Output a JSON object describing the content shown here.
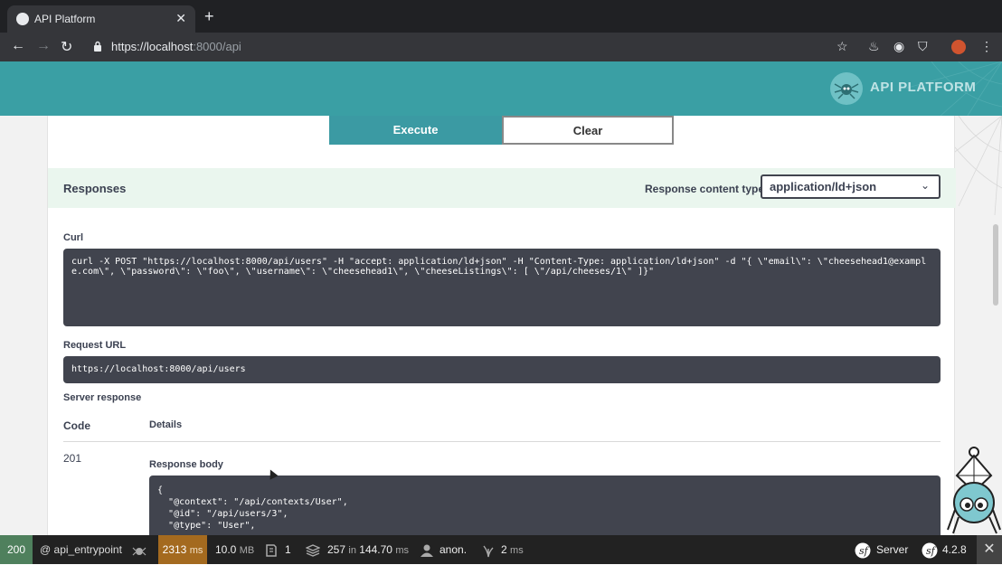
{
  "browser": {
    "tab_title": "API Platform",
    "tab_close": "✕",
    "new_tab": "+",
    "url_host": "https://localhost",
    "url_path": ":8000/api"
  },
  "header": {
    "logo_text": "API PLATFORM"
  },
  "actions": {
    "execute_label": "Execute",
    "clear_label": "Clear"
  },
  "responses": {
    "title": "Responses",
    "content_type_label": "Response content type",
    "content_type_value": "application/ld+json",
    "curl_label": "Curl",
    "curl_command": "curl -X POST \"https://localhost:8000/api/users\" -H \"accept: application/ld+json\" -H \"Content-Type: application/ld+json\" -d \"{ \\\"email\\\": \\\"cheesehead1@example.com\\\", \\\"password\\\": \\\"foo\\\", \\\"username\\\": \\\"cheesehead1\\\", \\\"cheeseListings\\\": [ \\\"/api/cheeses/1\\\" ]}\"",
    "request_url_label": "Request URL",
    "request_url": "https://localhost:8000/api/users",
    "server_response_label": "Server response",
    "code_header": "Code",
    "details_header": "Details",
    "code_value": "201",
    "response_body_label": "Response body",
    "response_body": "{\n  \"@context\": \"/api/contexts/User\",\n  \"@id\": \"/api/users/3\",\n  \"@type\": \"User\","
  },
  "debug_toolbar": {
    "status": "200",
    "route": "@ api_entrypoint",
    "time_value": "2313",
    "time_unit": "ms",
    "memory_value": "10.0",
    "memory_unit": "MB",
    "requests_count": "1",
    "db_queries": "257",
    "db_in": "in",
    "db_time": "144.70",
    "db_unit": "ms",
    "user": "anon.",
    "twig_time": "2",
    "twig_unit": "ms",
    "server_label": "Server",
    "symfony_version": "4.2.8",
    "close": "✕"
  },
  "colors": {
    "header_teal": "#3a9fa4",
    "execute_teal": "#3b9aa3",
    "status_green": "#4f805d",
    "time_orange": "#a46a1f",
    "code_bg": "#41444e"
  }
}
